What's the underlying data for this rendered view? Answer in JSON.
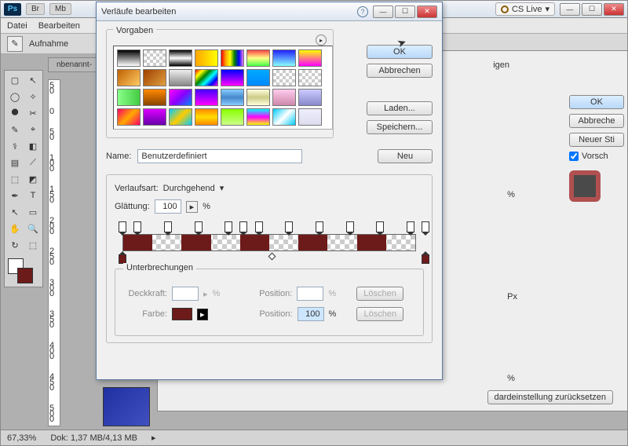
{
  "app": {
    "title_icon": "Ps",
    "chips": [
      "Br",
      "Mb"
    ],
    "cslive": "CS Live",
    "menu": [
      "Datei",
      "Bearbeiten"
    ],
    "optbar_label": "Aufnahme",
    "doc_tab": "nbenannt-",
    "zoom": "67,33%",
    "doc_size": "Dok: 1,37 MB/4,13 MB",
    "ruler_top": "50",
    "ruler_marks": [
      "5 0",
      "0",
      "5 0",
      "1 0 0",
      "1 5 0",
      "2 0 0",
      "2 5 0",
      "3 0 0",
      "3 5 0",
      "4 0 0",
      "4 5 0",
      "5 0 0"
    ]
  },
  "tools": [
    "▢",
    "↖",
    "◯",
    "✧",
    "⯃",
    "✂",
    "✎",
    "⌖",
    "⚕",
    "◧",
    "▤",
    "⟋",
    "⬚",
    "◩",
    "✒",
    "T",
    "↖",
    "▭",
    "✋",
    "🔍",
    "↻",
    "⬚"
  ],
  "swatch_fg": "#ffffff",
  "swatch_bg": "#6d1a1a",
  "layerstyle": {
    "ok": "OK",
    "cancel": "Abbreche",
    "newstyle": "Neuer Sti",
    "preview": "Vorsch",
    "units1": "%",
    "units2": "Px",
    "units3": "%",
    "reset": "dardeinstellung zurücksetzen",
    "igen": "igen"
  },
  "grad": {
    "title": "Verläufe bearbeiten",
    "presets_label": "Vorgaben",
    "ok": "OK",
    "cancel": "Abbrechen",
    "load": "Laden...",
    "save": "Speichern...",
    "name_label": "Name:",
    "name_value": "Benutzerdefiniert",
    "new_btn": "Neu",
    "type_label": "Verlaufsart:",
    "type_value": "Durchgehend",
    "smooth_label": "Glättung:",
    "smooth_value": "100",
    "pct": "%",
    "stops_label": "Unterbrechungen",
    "opacity_label": "Deckkraft:",
    "position_label": "Position:",
    "delete": "Löschen",
    "color_label": "Farbe:",
    "color_position": "100",
    "dark": "#6d1a1a",
    "segments": [
      {
        "l": 0,
        "w": 10
      },
      {
        "l": 20,
        "w": 10
      },
      {
        "l": 40,
        "w": 10
      },
      {
        "l": 60,
        "w": 10
      },
      {
        "l": 80,
        "w": 10
      }
    ],
    "ostops_pct": [
      0,
      5,
      15,
      25,
      35,
      40,
      45,
      55,
      65,
      75,
      85,
      95,
      100
    ],
    "cstops_pct": [
      0,
      100
    ]
  },
  "presets": [
    "linear-gradient(#000,#fff)",
    "repeating-conic-gradient(#ccc 0 25%,#fff 0 50%) 0 0/8px 8px",
    "linear-gradient(#000,#fff,#000)",
    "linear-gradient(90deg,orange,yellow)",
    "linear-gradient(90deg,red,orange,yellow,green,blue,violet)",
    "linear-gradient(#f44,#ff8,#4f4)",
    "linear-gradient(#22f,#8ff)",
    "linear-gradient(#ff0,#f0f)",
    "linear-gradient(135deg,#c06000,#ffcc66)",
    "linear-gradient(135deg,#a04000,#e0a040)",
    "linear-gradient(#eee,#888)",
    "linear-gradient(135deg,red,yellow,green,cyan,blue,magenta)",
    "linear-gradient(#00f,#f0f)",
    "linear-gradient(#0af,#08f)",
    "repeating-conic-gradient(#ccc 0 25%,#fff 0 50%) 0 0/8px 8px",
    "repeating-conic-gradient(#ccc 0 25%,#fff 0 50%) 0 0/8px 8px",
    "linear-gradient(90deg,#8f8,#4c4)",
    "linear-gradient(#f80,#840)",
    "linear-gradient(135deg,#f0f,#80f,#08f)",
    "linear-gradient(#40f,#f0f)",
    "linear-gradient(#8cf,#48c,#8cf)",
    "linear-gradient(#ffd,#cc8,#ffd)",
    "linear-gradient(#fce,#c8a)",
    "linear-gradient(#ccf,#88c)",
    "linear-gradient(135deg,#f06,#fa0,#f06)",
    "linear-gradient(#d0f,#60a)",
    "linear-gradient(135deg,#0cf,#fc0,#0cf)",
    "linear-gradient(#f80,#fd0,#f80)",
    "linear-gradient(#8f0,#cf8)",
    "linear-gradient(#0ff,#f0f,#ff0)",
    "linear-gradient(135deg,#0cf,#fff,#0cf)",
    "linear-gradient(#eef,#dde)"
  ]
}
